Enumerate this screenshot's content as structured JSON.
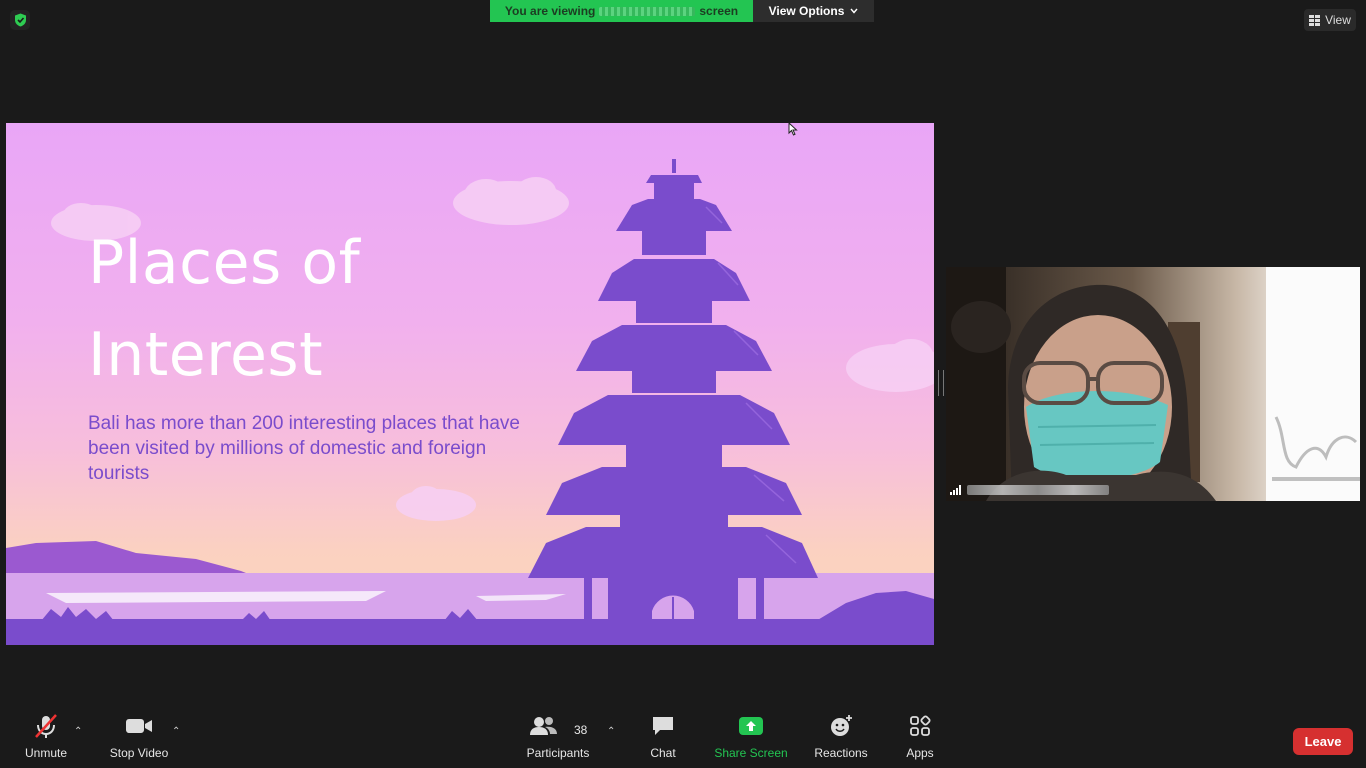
{
  "top": {
    "viewing_prefix": "You are viewing",
    "viewing_suffix": "screen",
    "view_options": "View Options",
    "view_button": "View"
  },
  "slide": {
    "title_line1": "Places of",
    "title_line2": "Interest",
    "body": "Bali has more than 200 interesting places that have been visited by millions of domestic and foreign tourists"
  },
  "toolbar": {
    "unmute": "Unmute",
    "stop_video": "Stop Video",
    "participants": "Participants",
    "participants_count": "38",
    "chat": "Chat",
    "share_screen": "Share Screen",
    "reactions": "Reactions",
    "apps": "Apps",
    "leave": "Leave"
  },
  "colors": {
    "share_green": "#23c552",
    "leave_red": "#d63030",
    "slide_purple": "#7a4ccc"
  },
  "icons": [
    "shield-icon",
    "chevron-down-icon",
    "grid-icon",
    "mic-muted-icon",
    "camera-icon",
    "participants-icon",
    "chat-icon",
    "share-screen-icon",
    "reactions-icon",
    "apps-icon",
    "signal-icon"
  ]
}
